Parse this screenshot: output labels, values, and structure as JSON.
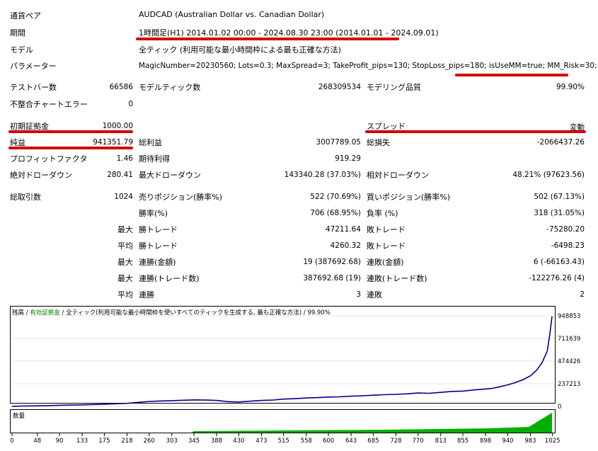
{
  "header": {
    "symbol_label": "通貨ペア",
    "symbol_value": "AUDCAD (Australian Dollar vs. Canadian Dollar)",
    "period_label": "期間",
    "period_value": "1時間足(H1) 2014.01.02 00:00 - 2024.08.30 23:00 (2014.01.01 - 2024.09.01)",
    "model_label": "モデル",
    "model_value": "全ティック (利用可能な最小時間枠による最も正確な方法)",
    "params_label": "パラメーター",
    "params_value": "MagicNumber=20230560; Lots=0.3; MaxSpread=3; TakeProfit_pips=130; StopLoss_pips=180; isUseMM=true; MM_Risk=30;"
  },
  "stats": {
    "bars_label": "テストバー数",
    "bars_value": "66586",
    "ticks_label": "モデルティック数",
    "ticks_value": "268309534",
    "quality_label": "モデリング品質",
    "quality_value": "99.90%",
    "mismatch_label": "不整合チャートエラー",
    "mismatch_value": "0",
    "deposit_label": "初期証拠金",
    "deposit_value": "1000.00",
    "spread_label": "スプレッド",
    "spread_value": "変動",
    "net_label": "純益",
    "net_value": "941351.79",
    "gross_profit_label": "総利益",
    "gross_profit_value": "3007789.05",
    "gross_loss_label": "総損失",
    "gross_loss_value": "-2066437.26",
    "pf_label": "プロフィットファクタ",
    "pf_value": "1.46",
    "expected_label": "期待利得",
    "expected_value": "919.29",
    "abs_dd_label": "絶対ドローダウン",
    "abs_dd_value": "280.41",
    "max_dd_label": "最大ドローダウン",
    "max_dd_value": "143340.28 (37.03%)",
    "rel_dd_label": "相対ドローダウン",
    "rel_dd_value": "48.21% (97623.56)",
    "total_trades_label": "総取引数",
    "total_trades_value": "1024",
    "short_label": "売りポジション(勝率%)",
    "short_value": "522 (70.69%)",
    "long_label": "買いポジション(勝率%)",
    "long_value": "502 (67.13%)",
    "winrate_label": "勝率(%)",
    "winrate_value": "706 (68.95%)",
    "lossrate_label": "負率 (%)",
    "lossrate_value": "318 (31.05%)",
    "max_word": "最大",
    "avg_word": "平均",
    "max_win_label": "勝トレード",
    "max_win_value": "47211.64",
    "max_loss_label": "敗トレード",
    "max_loss_value": "-75280.20",
    "avg_win_label": "勝トレード",
    "avg_win_value": "4260.32",
    "avg_loss_label": "敗トレード",
    "avg_loss_value": "-6498.23",
    "cons_wins_label": "連勝(金額)",
    "cons_wins_value": "19 (387692.68)",
    "cons_losses_label": "連敗(金額)",
    "cons_losses_value": "6 (-66163.43)",
    "cons_profit_label": "連勝(トレード数)",
    "cons_profit_value": "387692.68 (19)",
    "cons_loss_label": "連敗(トレード数)",
    "cons_loss_value": "-122276.26 (4)",
    "avg_cons_wins_label": "連勝",
    "avg_cons_wins_value": "3",
    "avg_cons_losses_label": "連敗",
    "avg_cons_losses_value": "2"
  },
  "chart_data": {
    "type": "line",
    "legend_balance": "残高",
    "legend_equity": "有効証拠金",
    "legend_model": "全ティック(利用可能な最小時間枠を使いすべてのティックを生成する, 最も正確な方法)",
    "legend_quality": "99.90%",
    "sep": " / ",
    "volume_label": "数量",
    "y_ticks": [
      0,
      237213,
      474426,
      711639,
      948853
    ],
    "ylim": [
      0,
      948853
    ],
    "x_ticks": [
      0,
      48,
      90,
      133,
      175,
      218,
      260,
      303,
      345,
      388,
      430,
      473,
      515,
      558,
      600,
      643,
      685,
      728,
      770,
      813,
      855,
      898,
      940,
      983,
      1025
    ],
    "xlim": [
      0,
      1024
    ],
    "series": [
      {
        "name": "残高",
        "x": [
          0,
          20,
          48,
          70,
          90,
          110,
          133,
          150,
          175,
          200,
          218,
          240,
          260,
          280,
          303,
          320,
          345,
          370,
          388,
          410,
          430,
          450,
          473,
          495,
          515,
          540,
          558,
          580,
          600,
          620,
          643,
          665,
          685,
          705,
          728,
          750,
          770,
          790,
          813,
          835,
          855,
          875,
          898,
          910,
          925,
          940,
          955,
          970,
          983,
          995,
          1005,
          1015,
          1020,
          1024
        ],
        "values": [
          1000,
          3500,
          6000,
          9000,
          12000,
          14000,
          16000,
          19000,
          23000,
          28000,
          32000,
          42000,
          52000,
          56000,
          60000,
          64000,
          68000,
          66000,
          62000,
          50000,
          46000,
          54000,
          62000,
          67000,
          76000,
          82000,
          88000,
          92000,
          98000,
          100000,
          107000,
          111000,
          117000,
          122000,
          126000,
          132000,
          140000,
          137000,
          147000,
          157000,
          160000,
          172000,
          182000,
          188000,
          205000,
          225000,
          250000,
          282000,
          320000,
          380000,
          455000,
          580000,
          760000,
          941351.79
        ]
      }
    ],
    "colors": {
      "balance": "#00008b",
      "equity": "#008000",
      "volume": "#00b000"
    }
  }
}
